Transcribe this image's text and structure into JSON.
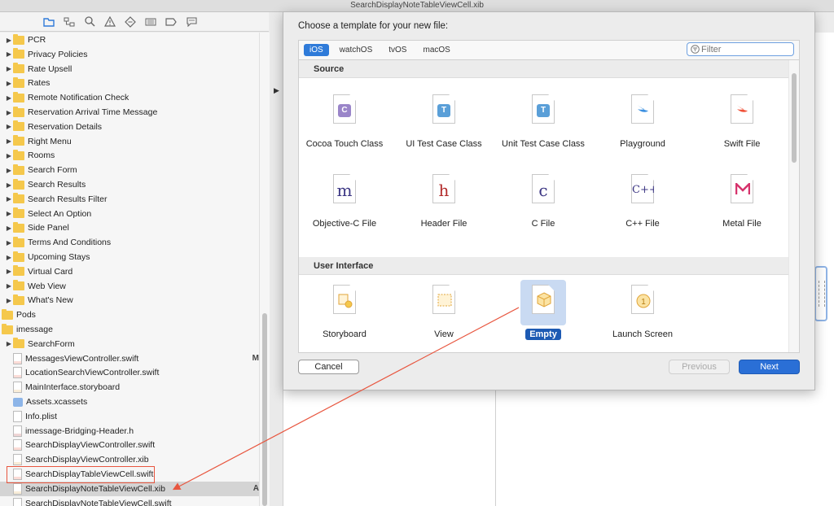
{
  "window": {
    "title": "SearchDisplayNoteTableViewCell.xib"
  },
  "navigator": {
    "rows": [
      {
        "label": "PCR",
        "type": "folder",
        "expandable": true,
        "indent": 1
      },
      {
        "label": "Privacy Policies",
        "type": "folder",
        "expandable": true,
        "indent": 1
      },
      {
        "label": "Rate Upsell",
        "type": "folder",
        "expandable": true,
        "indent": 1
      },
      {
        "label": "Rates",
        "type": "folder",
        "expandable": true,
        "indent": 1
      },
      {
        "label": "Remote Notification Check",
        "type": "folder",
        "expandable": true,
        "indent": 1
      },
      {
        "label": "Reservation Arrival Time Message",
        "type": "folder",
        "expandable": true,
        "indent": 1
      },
      {
        "label": "Reservation Details",
        "type": "folder",
        "expandable": true,
        "indent": 1
      },
      {
        "label": "Right Menu",
        "type": "folder",
        "expandable": true,
        "indent": 1
      },
      {
        "label": "Rooms",
        "type": "folder",
        "expandable": true,
        "indent": 1
      },
      {
        "label": "Search Form",
        "type": "folder",
        "expandable": true,
        "indent": 1
      },
      {
        "label": "Search Results",
        "type": "folder",
        "expandable": true,
        "indent": 1
      },
      {
        "label": "Search Results Filter",
        "type": "folder",
        "expandable": true,
        "indent": 1
      },
      {
        "label": "Select An Option",
        "type": "folder",
        "expandable": true,
        "indent": 1
      },
      {
        "label": "Side Panel",
        "type": "folder",
        "expandable": true,
        "indent": 1
      },
      {
        "label": "Terms And Conditions",
        "type": "folder",
        "expandable": true,
        "indent": 1
      },
      {
        "label": "Upcoming Stays",
        "type": "folder",
        "expandable": true,
        "indent": 1
      },
      {
        "label": "Virtual Card",
        "type": "folder",
        "expandable": true,
        "indent": 1
      },
      {
        "label": "Web View",
        "type": "folder",
        "expandable": true,
        "indent": 1
      },
      {
        "label": "What's New",
        "type": "folder",
        "expandable": true,
        "indent": 1
      },
      {
        "label": "Pods",
        "type": "folder",
        "expandable": false,
        "indent": 0
      },
      {
        "label": "imessage",
        "type": "folder",
        "expandable": false,
        "indent": 0
      },
      {
        "label": "SearchForm",
        "type": "folder",
        "expandable": true,
        "indent": 1
      },
      {
        "label": "MessagesViewController.swift",
        "type": "swift",
        "expandable": false,
        "indent": 1,
        "badge": "M"
      },
      {
        "label": "LocationSearchViewController.swift",
        "type": "swift",
        "expandable": false,
        "indent": 1
      },
      {
        "label": "MainInterface.storyboard",
        "type": "storyboard",
        "expandable": false,
        "indent": 1
      },
      {
        "label": "Assets.xcassets",
        "type": "assets",
        "expandable": false,
        "indent": 1
      },
      {
        "label": "Info.plist",
        "type": "plist",
        "expandable": false,
        "indent": 1
      },
      {
        "label": "imessage-Bridging-Header.h",
        "type": "header",
        "expandable": false,
        "indent": 1
      },
      {
        "label": "SearchDisplayViewController.swift",
        "type": "swift",
        "expandable": false,
        "indent": 1
      },
      {
        "label": "SearchDisplayViewController.xib",
        "type": "xib",
        "expandable": false,
        "indent": 1
      },
      {
        "label": "SearchDisplayTableViewCell.swift",
        "type": "swift",
        "expandable": false,
        "indent": 1
      },
      {
        "label": "SearchDisplayNoteTableViewCell.xib",
        "type": "xib",
        "expandable": false,
        "indent": 1,
        "badge": "A",
        "selected": true
      },
      {
        "label": "SearchDisplayNoteTableViewCell.swift",
        "type": "swift",
        "expandable": false,
        "indent": 1
      }
    ]
  },
  "sheet": {
    "title": "Choose a template for your new file:",
    "platforms": [
      {
        "label": "iOS",
        "active": true
      },
      {
        "label": "watchOS",
        "active": false
      },
      {
        "label": "tvOS",
        "active": false
      },
      {
        "label": "macOS",
        "active": false
      }
    ],
    "filter": {
      "placeholder": "Filter",
      "value": ""
    },
    "sections": [
      {
        "title": "Source"
      },
      {
        "title": "User Interface"
      }
    ],
    "source_tiles": [
      {
        "label": "Cocoa Touch Class",
        "icon": "cocoa-touch-class-icon"
      },
      {
        "label": "UI Test Case Class",
        "icon": "ui-test-case-class-icon"
      },
      {
        "label": "Unit Test Case Class",
        "icon": "unit-test-case-class-icon"
      },
      {
        "label": "Playground",
        "icon": "playground-icon"
      },
      {
        "label": "Swift File",
        "icon": "swift-file-icon"
      },
      {
        "label": "Objective-C File",
        "icon": "objective-c-file-icon"
      },
      {
        "label": "Header File",
        "icon": "header-file-icon"
      },
      {
        "label": "C File",
        "icon": "c-file-icon"
      },
      {
        "label": "C++ File",
        "icon": "cpp-file-icon"
      },
      {
        "label": "Metal File",
        "icon": "metal-file-icon"
      }
    ],
    "ui_tiles": [
      {
        "label": "Storyboard",
        "icon": "storyboard-icon"
      },
      {
        "label": "View",
        "icon": "view-icon"
      },
      {
        "label": "Empty",
        "icon": "empty-icon",
        "selected": true
      },
      {
        "label": "Launch Screen",
        "icon": "launch-screen-icon"
      }
    ],
    "glyphs": {
      "c_badge": "C",
      "t_badge": "T",
      "m": "m",
      "h": "h",
      "c": "c",
      "cpp": "C++",
      "one": "1"
    },
    "buttons": {
      "cancel": "Cancel",
      "previous": "Previous",
      "next": "Next"
    }
  },
  "colors": {
    "accent": "#2a6fd6",
    "annotation": "#e8563f",
    "folder": "#f5c84c"
  }
}
